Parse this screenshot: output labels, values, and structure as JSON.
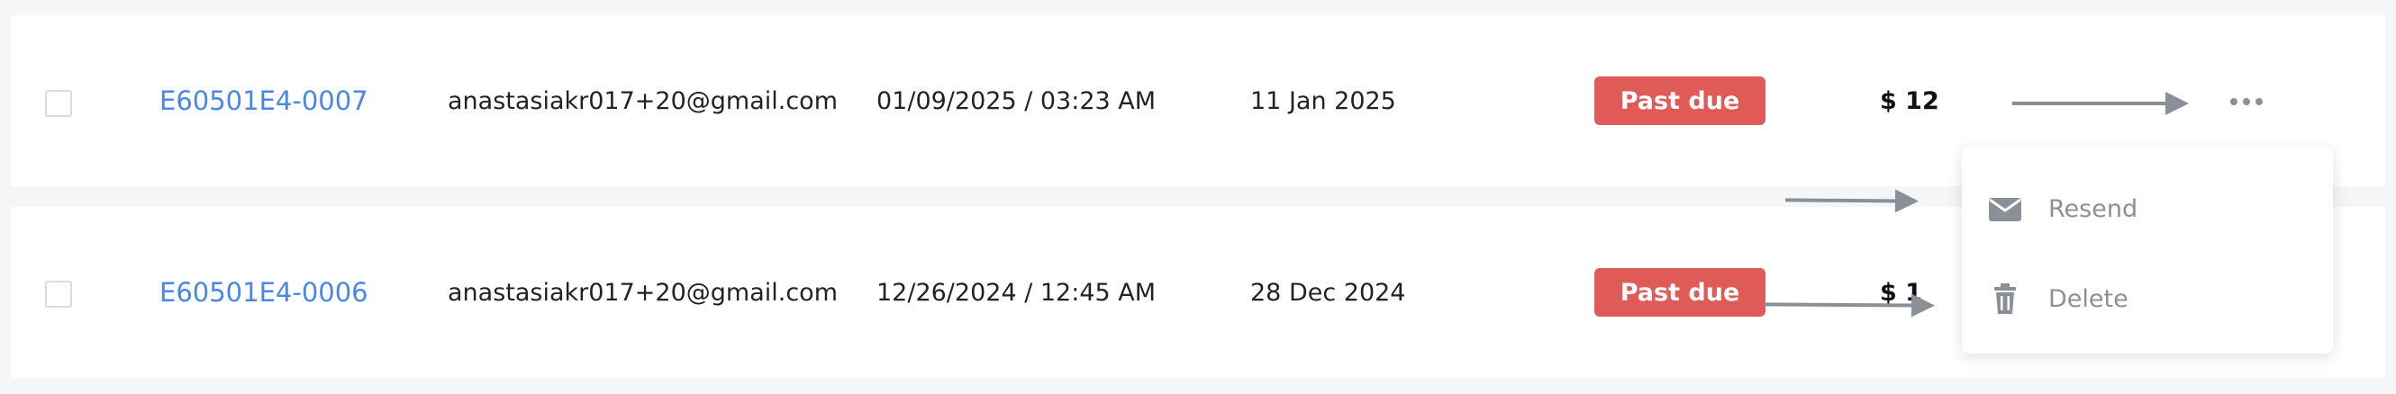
{
  "rows": [
    {
      "invoice_id": "E60501E4-0007",
      "email": "anastasiakr017+20@gmail.com",
      "created": "01/09/2025 / 03:23 AM",
      "due_date": "11 Jan 2025",
      "status": "Past due",
      "amount": "$ 12"
    },
    {
      "invoice_id": "E60501E4-0006",
      "email": "anastasiakr017+20@gmail.com",
      "created": "12/26/2024 / 12:45 AM",
      "due_date": "28 Dec 2024",
      "status": "Past due",
      "amount": "$ 1"
    }
  ],
  "menu": {
    "items": [
      {
        "label": "Resend",
        "icon": "envelope-icon"
      },
      {
        "label": "Delete",
        "icon": "trash-icon"
      }
    ]
  },
  "colors": {
    "link": "#4a86e8",
    "status_past_due": "#e05a57",
    "muted": "#8a8f98"
  }
}
